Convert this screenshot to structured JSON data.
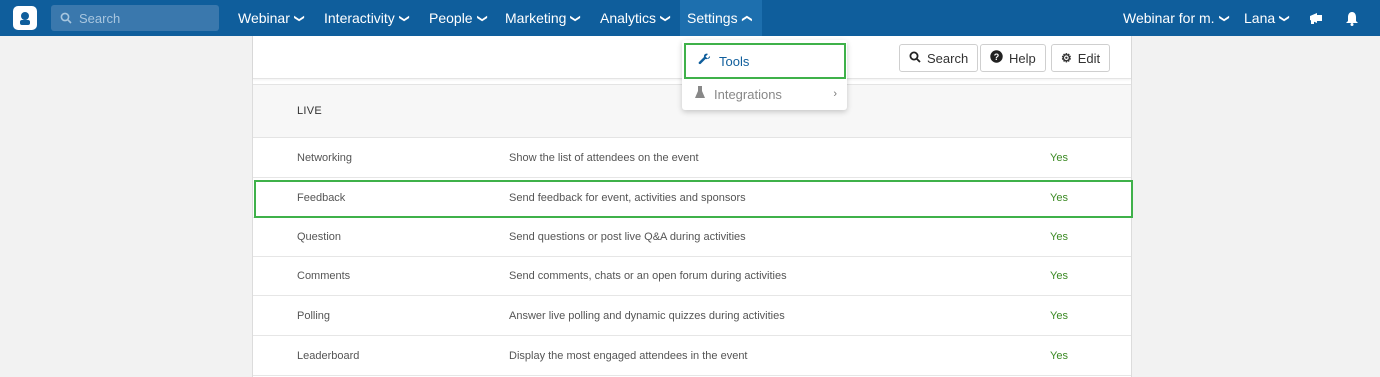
{
  "nav": {
    "search_placeholder": "Search",
    "items": [
      {
        "label": "Webinar"
      },
      {
        "label": "Interactivity"
      },
      {
        "label": "People"
      },
      {
        "label": "Marketing"
      },
      {
        "label": "Analytics"
      },
      {
        "label": "Settings"
      }
    ],
    "event": "Webinar for m.",
    "user": "Lana"
  },
  "toolbar": {
    "search": "Search",
    "help": "Help",
    "edit": "Edit"
  },
  "dropdown": {
    "tools": "Tools",
    "integrations": "Integrations"
  },
  "section": "LIVE",
  "rows": [
    {
      "name": "Networking",
      "desc": "Show the list of attendees on the event",
      "value": "Yes"
    },
    {
      "name": "Feedback",
      "desc": "Send feedback for event, activities and sponsors",
      "value": "Yes"
    },
    {
      "name": "Question",
      "desc": "Send questions or post live Q&A during activities",
      "value": "Yes"
    },
    {
      "name": "Comments",
      "desc": "Send comments, chats or an open forum during activities",
      "value": "Yes"
    },
    {
      "name": "Polling",
      "desc": "Answer live polling and dynamic quizzes during activities",
      "value": "Yes"
    },
    {
      "name": "Leaderboard",
      "desc": "Display the most engaged attendees in the event",
      "value": "Yes"
    }
  ],
  "colors": {
    "nav": "#0f5e9c",
    "highlight": "#3fb14a",
    "yes": "#3b8a23"
  },
  "icons": [
    "app-logo-icon",
    "search-icon",
    "chevron-down-icon",
    "chevron-up-icon",
    "megaphone-icon",
    "bell-icon",
    "question-circle-icon",
    "gear-icon",
    "wrench-icon",
    "flask-icon",
    "chevron-right-icon"
  ]
}
